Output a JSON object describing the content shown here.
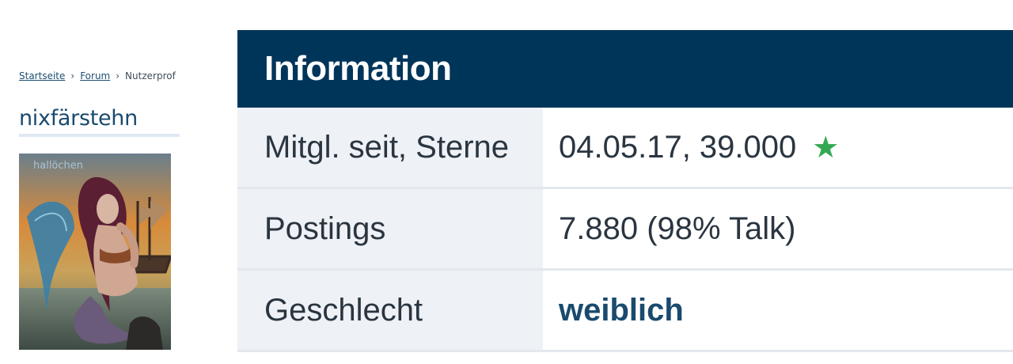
{
  "breadcrumb": {
    "items": [
      "Startseite",
      "Forum",
      "Nutzerprof"
    ]
  },
  "profile": {
    "username": "nixfärstehn",
    "avatar_caption": "hallöchen"
  },
  "info": {
    "title": "Information",
    "rows": [
      {
        "label": "Mitgl. seit, Sterne",
        "value": "04.05.17, 39.000"
      },
      {
        "label": "Postings",
        "value": "7.880 (98% Talk)"
      },
      {
        "label": "Geschlecht",
        "value": "weiblich"
      }
    ]
  },
  "icons": {
    "star": "star-icon",
    "chevron": "chevron-right-icon"
  },
  "colors": {
    "header_bg": "#00355a",
    "link": "#1d4f73",
    "star": "#34a853"
  }
}
